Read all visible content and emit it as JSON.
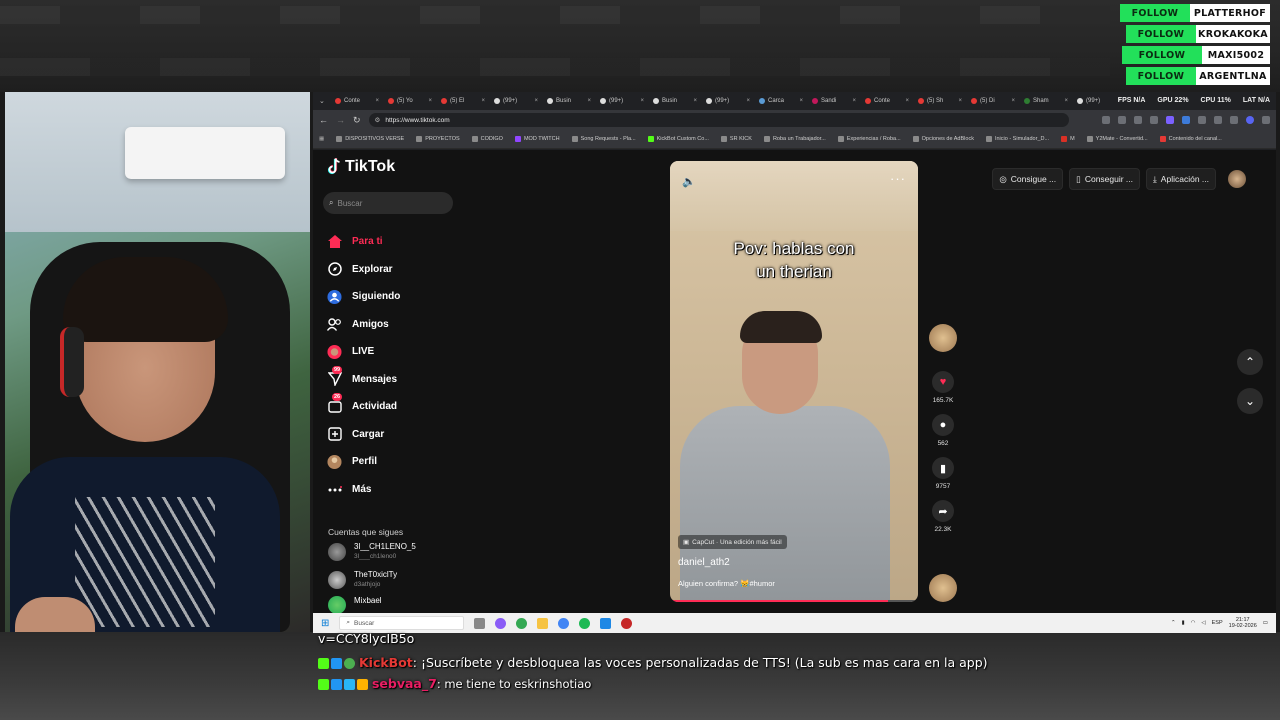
{
  "follow_overlay": [
    {
      "action": "FOLLOW",
      "name": "PLATTERHOF"
    },
    {
      "action": "FOLLOW",
      "name": "KROKAKOKA"
    },
    {
      "action": "FOLLOW",
      "name": "MAXI5002"
    },
    {
      "action": "FOLLOW",
      "name": "ARGENTLNA"
    }
  ],
  "browser": {
    "tabs": [
      "Conte",
      "(5) Yo",
      "(5) El",
      "(99+)",
      "Busin",
      "(99+)",
      "Busin",
      "(99+)",
      "Carca",
      "Sandi",
      "Conte",
      "(5) Sh",
      "(5) Di",
      "Sham",
      "(99+)"
    ],
    "stats": [
      "FPS N/A",
      "GPU 22%",
      "CPU 11%",
      "LAT N/A"
    ],
    "url": "https://www.tiktok.com",
    "bookmarks": [
      "DISPOSITIVOS VERSE",
      "PROYECTOS",
      "CODIGO",
      "MOD TWITCH",
      "Song Requests - Pla...",
      "KickBot Custom Co...",
      "SR KICK",
      "Roba un Trabajador...",
      "Experiencias / Roba...",
      "Opciones de AdBlock",
      "Inicio - Simulador_D...",
      "M",
      "Y2Mate - Convertid...",
      "Contenido del canal..."
    ]
  },
  "tiktok": {
    "logo": "TikTok",
    "search_placeholder": "Buscar",
    "nav": [
      {
        "label": "Para ti",
        "icon": "home-icon",
        "badge": ""
      },
      {
        "label": "Explorar",
        "icon": "compass-icon",
        "badge": ""
      },
      {
        "label": "Siguiendo",
        "icon": "following-icon",
        "badge": ""
      },
      {
        "label": "Amigos",
        "icon": "friends-icon",
        "badge": ""
      },
      {
        "label": "LIVE",
        "icon": "live-icon",
        "badge": ""
      },
      {
        "label": "Mensajes",
        "icon": "messages-icon",
        "badge": "99"
      },
      {
        "label": "Actividad",
        "icon": "activity-icon",
        "badge": "26"
      },
      {
        "label": "Cargar",
        "icon": "upload-icon",
        "badge": ""
      },
      {
        "label": "Perfil",
        "icon": "profile-icon",
        "badge": ""
      },
      {
        "label": "Más",
        "icon": "more-icon",
        "badge": ""
      }
    ],
    "following_title": "Cuentas que sigues",
    "following": [
      {
        "name": "3l__CH1LENO_5",
        "handle": "3l___ch1leno0"
      },
      {
        "name": "TheT0xiclTy",
        "handle": "d3athjojo"
      },
      {
        "name": "Mixbael",
        "handle": ""
      }
    ],
    "video": {
      "caption_line1": "Pov: hablas con",
      "caption_line2": "un therian",
      "capcut": "CapCut · Una edición más fácil",
      "username": "daniel_ath2",
      "description": "Alguien confirma? 😹#humor",
      "progress": 0.88
    },
    "actions": {
      "likes": "165.7K",
      "comments": "562",
      "saves": "9757",
      "shares": "22.3K"
    },
    "top_buttons": [
      "Consigue ...",
      "Conseguir ...",
      "Aplicación ..."
    ]
  },
  "taskbar": {
    "search_placeholder": "Buscar",
    "lang": "ESP",
    "time": "21:17",
    "date": "19-02-2026"
  },
  "chat": {
    "line0": "v=CCY8lycIB5o",
    "kickbot_user": "KickBot",
    "kickbot_msg": ": ¡Suscríbete y desbloquea las voces personalizadas de TTS! (La sub es mas cara en la app)",
    "user2": "sebvaa_7",
    "msg2": ": me tiene to eskrinshotiao",
    "colors": {
      "kickbot": "#e53935",
      "user2": "#e91e63"
    }
  }
}
